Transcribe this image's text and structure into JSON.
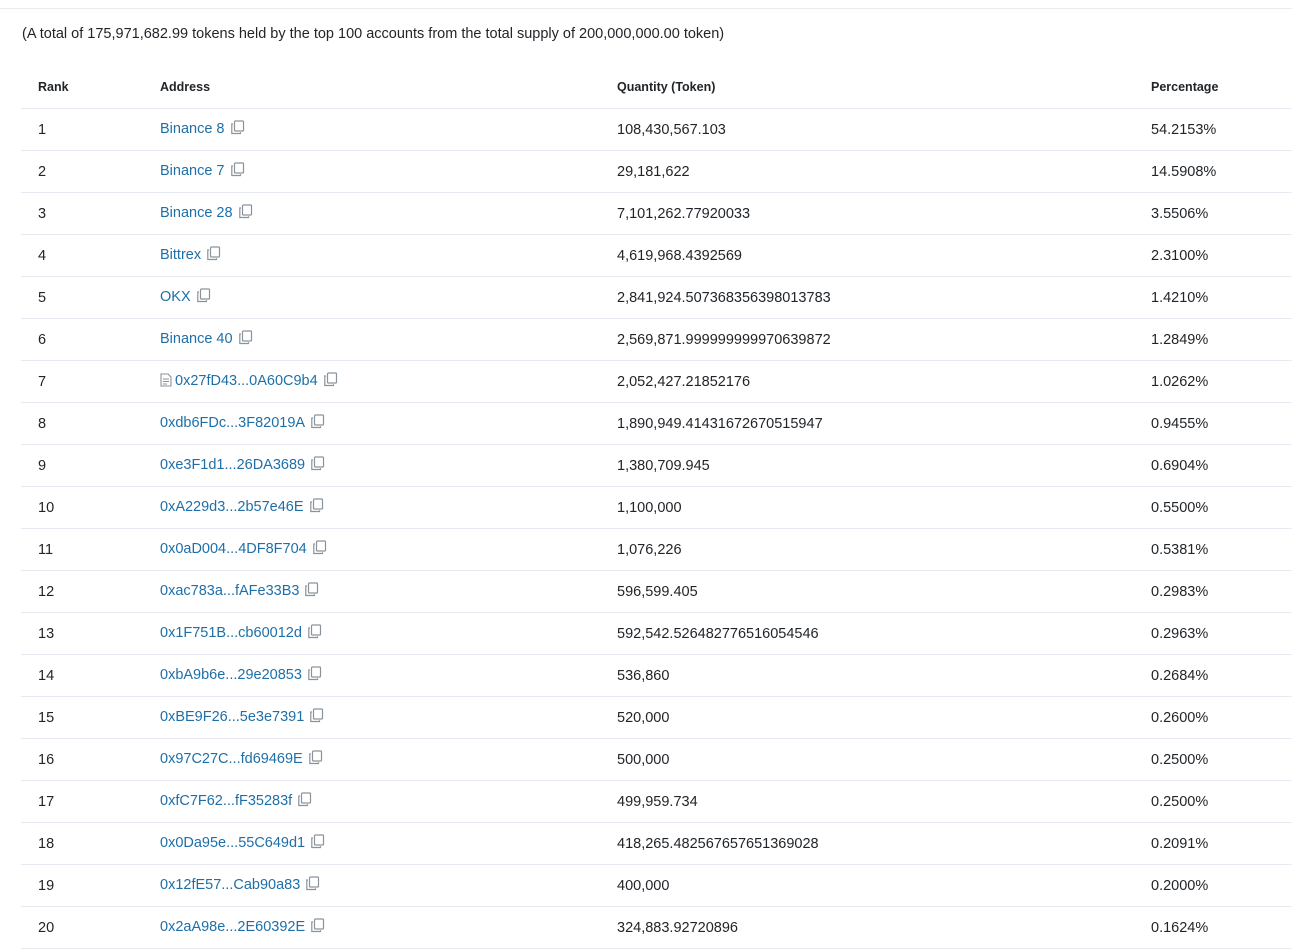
{
  "summary_text": "(A total of 175,971,682.99 tokens held by the top 100 accounts from the total supply of 200,000,000.00 token)",
  "columns": {
    "rank": "Rank",
    "address": "Address",
    "quantity": "Quantity (Token)",
    "percentage": "Percentage"
  },
  "colors": {
    "link": "#1e6fa8",
    "text": "#212529",
    "border": "#e7eaf3",
    "icon": "#77838f"
  },
  "rows": [
    {
      "rank": "1",
      "address": "Binance 8",
      "quantity": "108,430,567.103",
      "percentage": "54.2153%"
    },
    {
      "rank": "2",
      "address": "Binance 7",
      "quantity": "29,181,622",
      "percentage": "14.5908%"
    },
    {
      "rank": "3",
      "address": "Binance 28",
      "quantity": "7,101,262.77920033",
      "percentage": "3.5506%"
    },
    {
      "rank": "4",
      "address": "Bittrex",
      "quantity": "4,619,968.4392569",
      "percentage": "2.3100%"
    },
    {
      "rank": "5",
      "address": "OKX",
      "quantity": "2,841,924.507368356398013783",
      "percentage": "1.4210%"
    },
    {
      "rank": "6",
      "address": "Binance 40",
      "quantity": "2,569,871.999999999970639872",
      "percentage": "1.2849%"
    },
    {
      "rank": "7",
      "address": "0x27fD43...0A60C9b4",
      "quantity": "2,052,427.21852176",
      "percentage": "1.0262%",
      "contract_icon": "document-icon"
    },
    {
      "rank": "8",
      "address": "0xdb6FDc...3F82019A",
      "quantity": "1,890,949.41431672670515947",
      "percentage": "0.9455%"
    },
    {
      "rank": "9",
      "address": "0xe3F1d1...26DA3689",
      "quantity": "1,380,709.945",
      "percentage": "0.6904%"
    },
    {
      "rank": "10",
      "address": "0xA229d3...2b57e46E",
      "quantity": "1,100,000",
      "percentage": "0.5500%"
    },
    {
      "rank": "11",
      "address": "0x0aD004...4DF8F704",
      "quantity": "1,076,226",
      "percentage": "0.5381%"
    },
    {
      "rank": "12",
      "address": "0xac783a...fAFe33B3",
      "quantity": "596,599.405",
      "percentage": "0.2983%"
    },
    {
      "rank": "13",
      "address": "0x1F751B...cb60012d",
      "quantity": "592,542.526482776516054546",
      "percentage": "0.2963%"
    },
    {
      "rank": "14",
      "address": "0xbA9b6e...29e20853",
      "quantity": "536,860",
      "percentage": "0.2684%"
    },
    {
      "rank": "15",
      "address": "0xBE9F26...5e3e7391",
      "quantity": "520,000",
      "percentage": "0.2600%"
    },
    {
      "rank": "16",
      "address": "0x97C27C...fd69469E",
      "quantity": "500,000",
      "percentage": "0.2500%"
    },
    {
      "rank": "17",
      "address": "0xfC7F62...fF35283f",
      "quantity": "499,959.734",
      "percentage": "0.2500%"
    },
    {
      "rank": "18",
      "address": "0x0Da95e...55C649d1",
      "quantity": "418,265.482567657651369028",
      "percentage": "0.2091%"
    },
    {
      "rank": "19",
      "address": "0x12fE57...Cab90a83",
      "quantity": "400,000",
      "percentage": "0.2000%"
    },
    {
      "rank": "20",
      "address": "0x2aA98e...2E60392E",
      "quantity": "324,883.92720896",
      "percentage": "0.1624%"
    }
  ]
}
